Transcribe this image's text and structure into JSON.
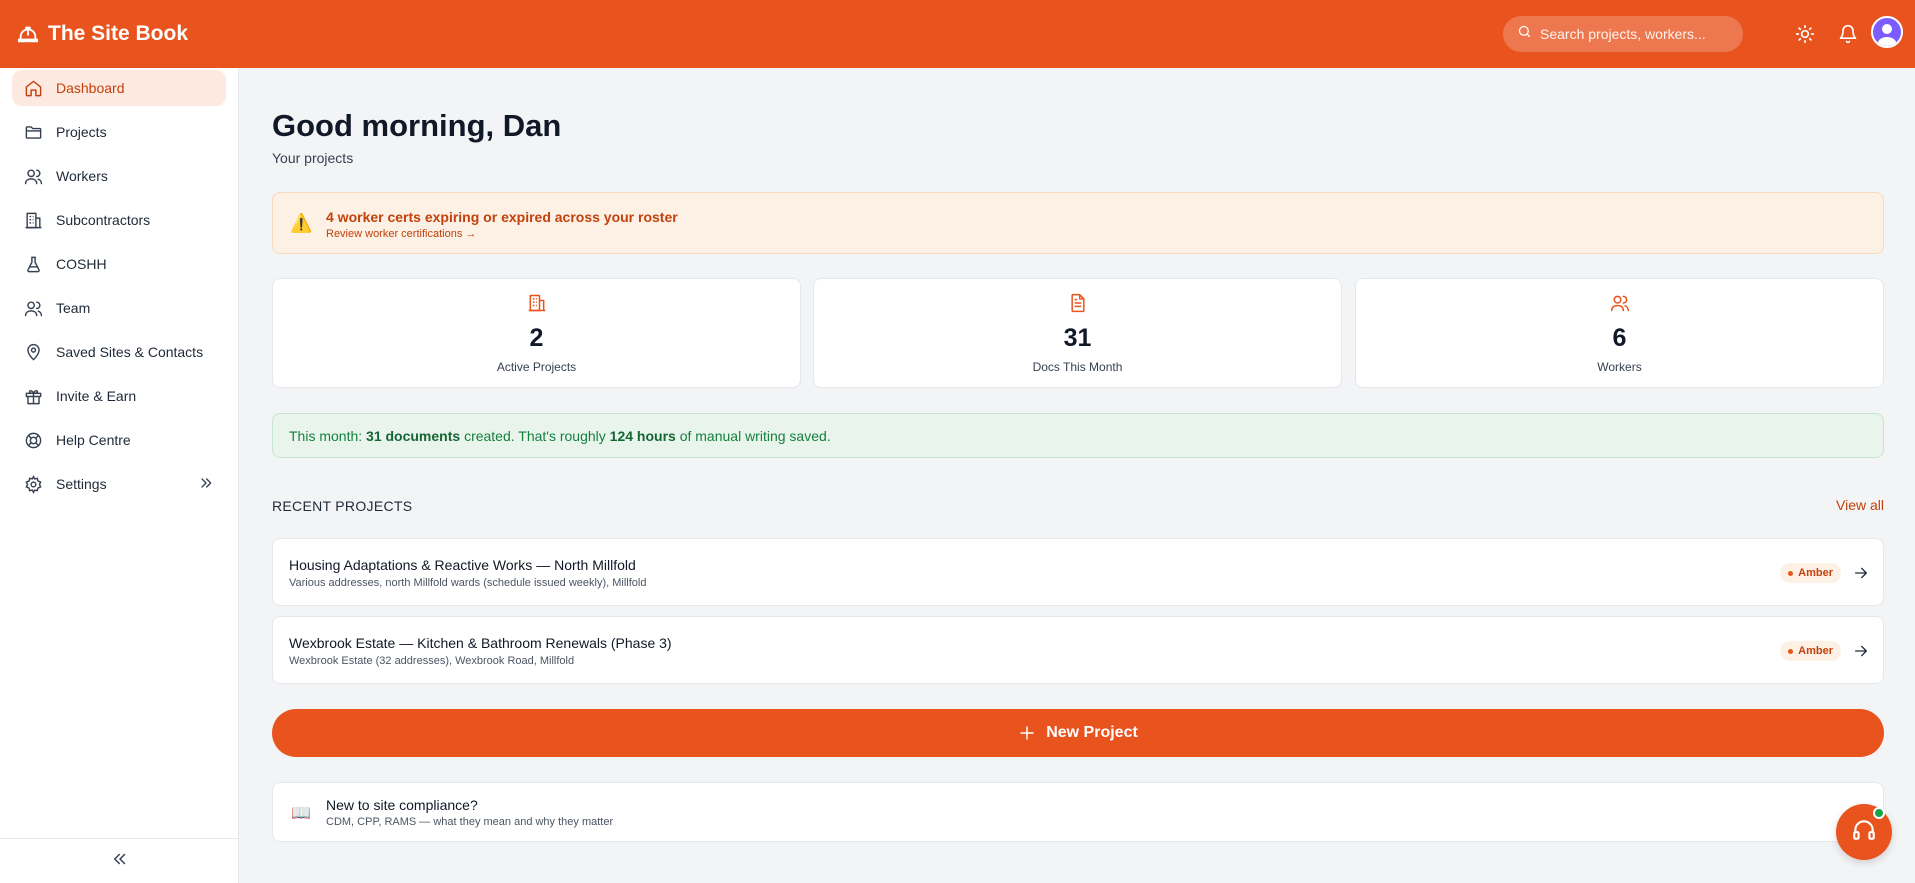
{
  "app": {
    "title": "The Site Book"
  },
  "header": {
    "search_placeholder": "Search projects, workers..."
  },
  "sidebar": {
    "items": [
      {
        "label": "Dashboard",
        "icon": "home-icon",
        "active": true
      },
      {
        "label": "Projects",
        "icon": "folder-icon"
      },
      {
        "label": "Workers",
        "icon": "users-icon"
      },
      {
        "label": "Subcontractors",
        "icon": "building-icon"
      },
      {
        "label": "COSHH",
        "icon": "flask-icon"
      },
      {
        "label": "Team",
        "icon": "team-icon"
      },
      {
        "label": "Saved Sites & Contacts",
        "icon": "map-pin-icon"
      },
      {
        "label": "Invite & Earn",
        "icon": "gift-icon"
      },
      {
        "label": "Help Centre",
        "icon": "lifebuoy-icon"
      },
      {
        "label": "Settings",
        "icon": "gear-icon"
      }
    ]
  },
  "main": {
    "greeting": "Good morning, Dan",
    "subtitle": "Your projects",
    "alert": {
      "title": "4 worker certs expiring or expired across your roster",
      "link": "Review worker certifications →"
    },
    "stats": [
      {
        "value": "2",
        "label": "Active Projects"
      },
      {
        "value": "31",
        "label": "Docs This Month"
      },
      {
        "value": "6",
        "label": "Workers"
      }
    ],
    "savings": {
      "prefix": "This month:",
      "docs": "31 documents",
      "middle": "created. That's roughly",
      "hours": "124 hours",
      "suffix": "of manual writing saved."
    },
    "recent": {
      "title": "RECENT PROJECTS",
      "view_all": "View all",
      "projects": [
        {
          "name": "Housing Adaptations & Reactive Works — North Millfold",
          "address": "Various addresses, north Millfold wards (schedule issued weekly), Millfold",
          "status": "Amber"
        },
        {
          "name": "Wexbrook Estate — Kitchen & Bathroom Renewals (Phase 3)",
          "address": "Wexbrook Estate (32 addresses), Wexbrook Road, Millfold",
          "status": "Amber"
        }
      ]
    },
    "new_project": "New Project",
    "guide": {
      "title": "New to site compliance?",
      "subtitle": "CDM, CPP, RAMS — what they mean and why they matter"
    }
  },
  "colors": {
    "brand": "#e8531e",
    "success": "#15803d",
    "warning": "#c2410c"
  }
}
